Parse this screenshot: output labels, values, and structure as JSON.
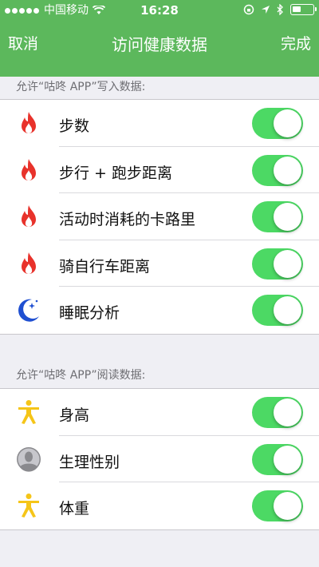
{
  "status_bar": {
    "carrier": "中国移动",
    "time": "16:28"
  },
  "nav": {
    "cancel_label": "取消",
    "title": "访问健康数据",
    "done_label": "完成"
  },
  "write_section": {
    "header": "允许“咕咚 APP”写入数据:",
    "items": [
      {
        "label": "步数",
        "icon": "flame-icon",
        "on": true
      },
      {
        "label": "步行 + 跑步距离",
        "icon": "flame-icon",
        "on": true
      },
      {
        "label": "活动时消耗的卡路里",
        "icon": "flame-icon",
        "on": true
      },
      {
        "label": "骑自行车距离",
        "icon": "flame-icon",
        "on": true
      },
      {
        "label": "睡眠分析",
        "icon": "moon-icon",
        "on": true
      }
    ]
  },
  "read_section": {
    "header": "允许“咕咚 APP”阅读数据:",
    "items": [
      {
        "label": "身高",
        "icon": "person-icon",
        "on": true
      },
      {
        "label": "生理性别",
        "icon": "profile-icon",
        "on": true
      },
      {
        "label": "体重",
        "icon": "person-icon",
        "on": true
      }
    ]
  },
  "colors": {
    "nav_green": "#5cb85c",
    "switch_green": "#4cd964",
    "flame_red": "#e8322b",
    "moon_blue": "#1f4fd1",
    "person_yellow": "#f5c518"
  }
}
